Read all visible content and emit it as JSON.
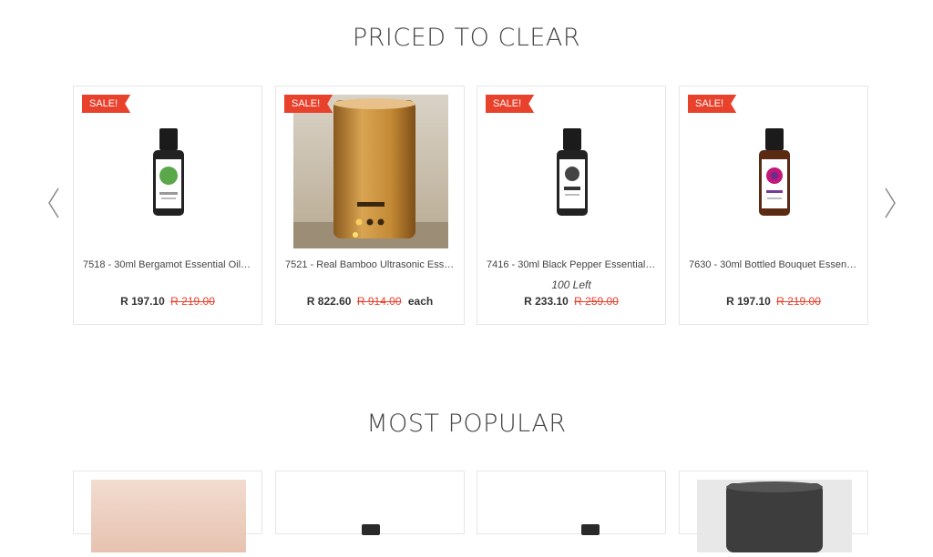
{
  "sections": [
    {
      "title": "PRICED TO CLEAR"
    },
    {
      "title": "MOST POPULAR"
    }
  ],
  "carousel": {
    "prev_icon": "chevron-left-icon",
    "next_icon": "chevron-right-icon"
  },
  "products": [
    {
      "badge": "SALE!",
      "name": "7518 - 30ml Bergamot Essential Oil - ...",
      "price": "R 197.10",
      "old_price": "R 219.00",
      "stock": "",
      "unit": ""
    },
    {
      "badge": "SALE!",
      "name": "7521 - Real Bamboo Ultrasonic Esse...",
      "price": "R 822.60",
      "old_price": "R 914.00",
      "stock": "",
      "unit": "each"
    },
    {
      "badge": "SALE!",
      "name": "7416 - 30ml Black Pepper Essential ...",
      "price": "R 233.10",
      "old_price": "R 259.00",
      "stock": "100 Left",
      "unit": ""
    },
    {
      "badge": "SALE!",
      "name": "7630 - 30ml Bottled Bouquet Essenti...",
      "price": "R 197.10",
      "old_price": "R 219.00",
      "stock": "",
      "unit": ""
    }
  ],
  "colors": {
    "sale": "#e8412c",
    "title": "#444444"
  }
}
